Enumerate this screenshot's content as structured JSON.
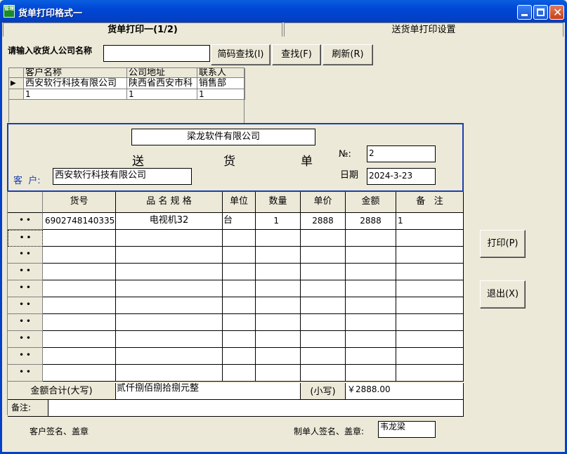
{
  "window": {
    "title": "货单打印格式一",
    "app_icon_text": "管理"
  },
  "tabs": [
    {
      "label": "货单打印一(1/2)"
    },
    {
      "label": "送货单打印设置"
    }
  ],
  "search": {
    "label": "请输入收货人公司名称",
    "value": "",
    "btn_code": "简码查找(I)",
    "btn_find": "查找(F)",
    "btn_refresh": "刷新(R)"
  },
  "customer_grid": {
    "headers": [
      "客户名称",
      "公司地址",
      "联系人"
    ],
    "rows": [
      [
        "西安软行科技有限公司",
        "陕西省西安市科",
        "销售部"
      ],
      [
        "1",
        "1",
        "1"
      ]
    ]
  },
  "form": {
    "company": "梁龙软件有限公司",
    "title_chars": [
      "送",
      "货",
      "单"
    ],
    "no_label": "№:",
    "no_value": "2",
    "date_label": "日期",
    "date_value": "2024-3-23",
    "customer_label": "客  户:",
    "customer_value": "西安软行科技有限公司"
  },
  "items": {
    "headers": [
      "货号",
      "品 名 规 格",
      "单位",
      "数量",
      "单价",
      "金额",
      "备   注"
    ],
    "row_marker": "• •",
    "rows": [
      [
        "6902748140335",
        "电视机32",
        "台",
        "1",
        "2888",
        "2888",
        "1"
      ]
    ],
    "empty_rows": 9
  },
  "totals": {
    "label_upper": "金额合计(大写)",
    "upper_value": "贰仟捌佰捌拾捌元整",
    "label_lower": "(小写)",
    "lower_value": "￥2888.00",
    "remark_label": "备注:",
    "remark_value": ""
  },
  "footer": {
    "customer_sign": "客户签名、盖章",
    "maker_sign": "制单人签名、盖章:",
    "maker_value": "韦龙梁"
  },
  "side_buttons": {
    "print": "打印(P)",
    "exit": "退出(X)"
  }
}
